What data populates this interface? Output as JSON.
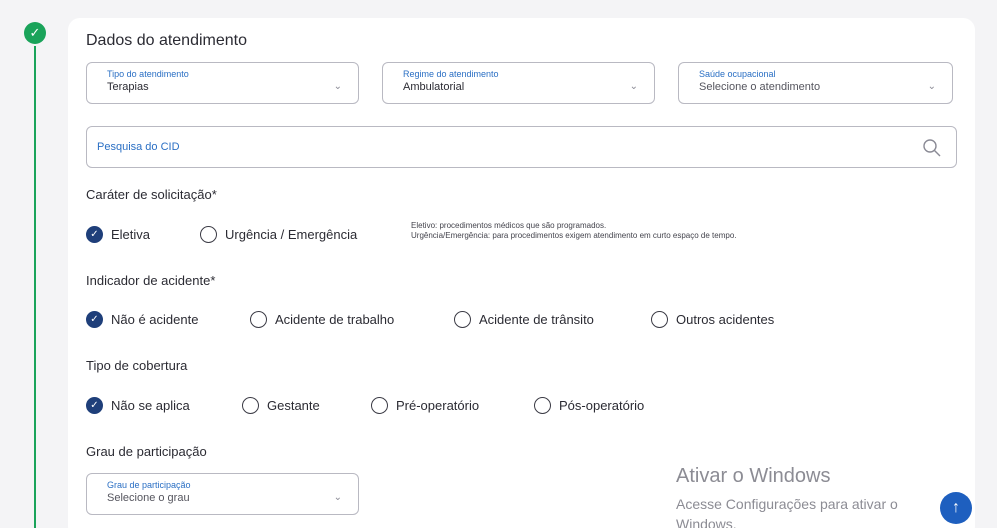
{
  "section": {
    "title": "Dados do atendimento"
  },
  "fields": {
    "tipo": {
      "label": "Tipo do atendimento",
      "value": "Terapias"
    },
    "regime": {
      "label": "Regime do atendimento",
      "value": "Ambulatorial"
    },
    "saude": {
      "label": "Saúde ocupacional",
      "placeholder": "Selecione o atendimento"
    },
    "grau": {
      "label": "Grau de participação",
      "placeholder": "Selecione o grau"
    }
  },
  "search": {
    "placeholder": "Pesquisa do CID",
    "icon": "search-icon"
  },
  "carater": {
    "label": "Caráter de solicitação*",
    "options": [
      "Eletiva",
      "Urgência / Emergência"
    ],
    "selected": "Eletiva",
    "hint_line1": "Eletivo: procedimentos médicos que são programados.",
    "hint_line2": "Urgência/Emergência: para procedimentos exigem atendimento em curto espaço de tempo."
  },
  "acidente": {
    "label": "Indicador de acidente*",
    "options": [
      "Não é acidente",
      "Acidente de trabalho",
      "Acidente de trânsito",
      "Outros acidentes"
    ],
    "selected": "Não é acidente"
  },
  "cobertura": {
    "label": "Tipo de cobertura",
    "options": [
      "Não se aplica",
      "Gestante",
      "Pré-operatório",
      "Pós-operatório"
    ],
    "selected": "Não se aplica"
  },
  "participacao": {
    "label": "Grau de participação"
  },
  "watermark": {
    "line1": "Ativar o Windows",
    "line2": "Acesse Configurações para ativar o",
    "line3": "Windows."
  },
  "colors": {
    "accent": "#1aa35a",
    "selected": "#1f3f7a",
    "link": "#2a6fc4",
    "scroll_button": "#1e5fbf"
  },
  "icons": {
    "step": "check-icon",
    "chevron": "chevron-down-icon",
    "scroll_top": "arrow-up-icon"
  }
}
